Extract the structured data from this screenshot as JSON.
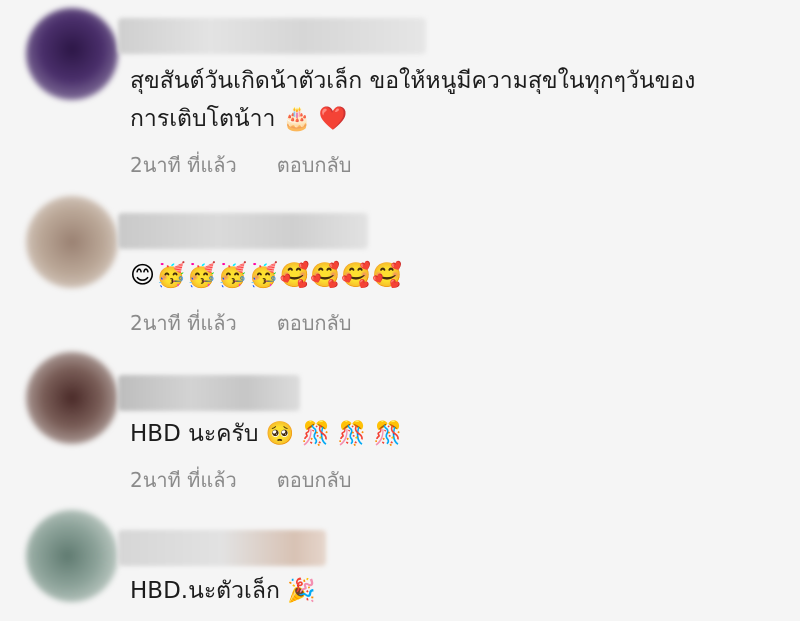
{
  "comments": [
    {
      "avatar_color": "#4a2f6b",
      "text_line1": "สุขสันต์วันเกิดน้าตัวเล็ก ขอให้หนูมีความสุขในทุกๆวันของ",
      "text_line2": "การเติบโตน้าา 🎂 ❤️",
      "time": "2นาที ที่แล้ว",
      "reply": "ตอบกลับ"
    },
    {
      "avatar_color": "#b8a89c",
      "emojis": "😊🥳🥳🥳🥳🥰🥰🥰🥰",
      "time": "2นาที ที่แล้ว",
      "reply": "ตอบกลับ"
    },
    {
      "avatar_color": "#7a5e58",
      "text": "HBD นะครับ 🥺 🎊 🎊 🎊",
      "time": "2นาที ที่แล้ว",
      "reply": "ตอบกลับ"
    },
    {
      "avatar_color": "#8da39a",
      "text": "HBD.นะตัวเล็ก 🎉"
    }
  ]
}
